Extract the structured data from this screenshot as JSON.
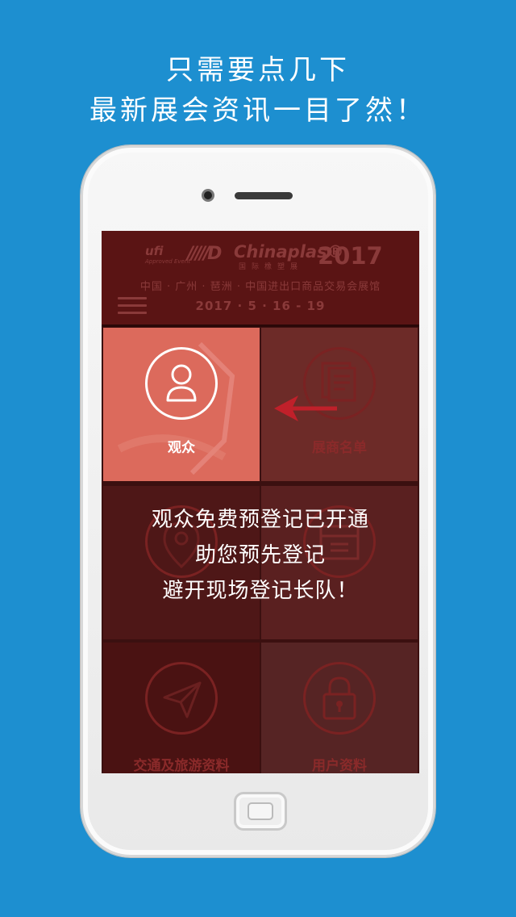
{
  "headline": {
    "line1": "只需要点几下",
    "line2": "最新展会资讯一目了然！"
  },
  "app": {
    "header": {
      "logo_ufi": "ufi",
      "logo_ufi_sub": "Approved Event",
      "brand_mark": "/////D",
      "brand_name": "Chinaplas®",
      "brand_sub": "国际橡塑展",
      "brand_year": "2017",
      "venue": "中国 · 广州 · 琶洲 · 中国进出口商品交易会展馆",
      "dates": "2017 · 5 · 16 - 19"
    },
    "tiles": [
      {
        "label": "观众",
        "icon": "user-icon"
      },
      {
        "label": "展商名单",
        "icon": "document-icon"
      },
      {
        "label": "",
        "icon": "location-pin-icon"
      },
      {
        "label": "",
        "icon": "calendar-icon"
      },
      {
        "label": "交通及旅游资料",
        "icon": "paper-plane-icon"
      },
      {
        "label": "用户资料",
        "icon": "lock-icon"
      }
    ],
    "overlay": {
      "line1": "观众免费预登记已开通",
      "line2": "助您预先登记",
      "line3": "避开现场登记长队！"
    }
  },
  "colors": {
    "background": "#1d8fd0",
    "highlight_tile": "#dc6a5c",
    "arrow": "#c0202a"
  }
}
